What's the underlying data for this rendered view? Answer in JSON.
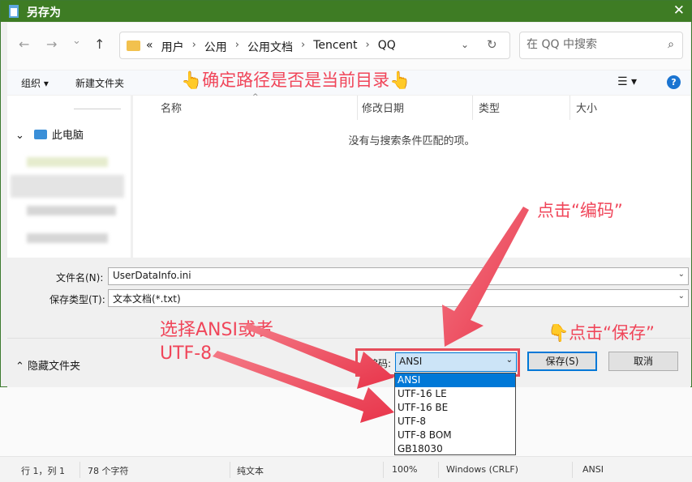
{
  "dialog": {
    "title": "另存为",
    "nav": {
      "back": "←",
      "forward": "→",
      "history": "⌄",
      "up": "↑"
    },
    "breadcrumb": [
      "«",
      "用户",
      "公用",
      "公用文档",
      "Tencent",
      "QQ"
    ],
    "search_placeholder": "在 QQ 中搜索",
    "toolbar": {
      "organize": "组织 ▾",
      "new_folder": "新建文件夹"
    },
    "sidebar": {
      "this_pc": "此电脑"
    },
    "columns": [
      "名称",
      "修改日期",
      "类型",
      "大小"
    ],
    "empty_message": "没有与搜索条件匹配的项。",
    "filename_label": "文件名(N):",
    "filename_value": "UserDataInfo.ini",
    "filetype_label": "保存类型(T):",
    "filetype_value": "文本文档(*.txt)",
    "hide_folders": "隐藏文件夹",
    "encoding_label": "编码:",
    "encoding_value": "ANSI",
    "encoding_options": [
      "ANSI",
      "UTF-16 LE",
      "UTF-16 BE",
      "UTF-8",
      "UTF-8 BOM",
      "GB18030"
    ],
    "save_button": "保存(S)",
    "cancel_button": "取消"
  },
  "annotations": {
    "path_check": "确定路径是否是当前目录",
    "click_encoding": "点击“编码”",
    "choose_encoding_line1": "选择ANSI或者",
    "choose_encoding_line2": "UTF-8",
    "click_save": "点击“保存”"
  },
  "statusbar": {
    "position": "行 1，列 1",
    "chars": "78 个字符",
    "format": "纯文本",
    "zoom": "100%",
    "line_ending": "Windows (CRLF)",
    "encoding": "ANSI"
  },
  "colors": {
    "titlebar": "#3e7c24",
    "annotation": "#f0465a",
    "accent": "#0078d7"
  }
}
